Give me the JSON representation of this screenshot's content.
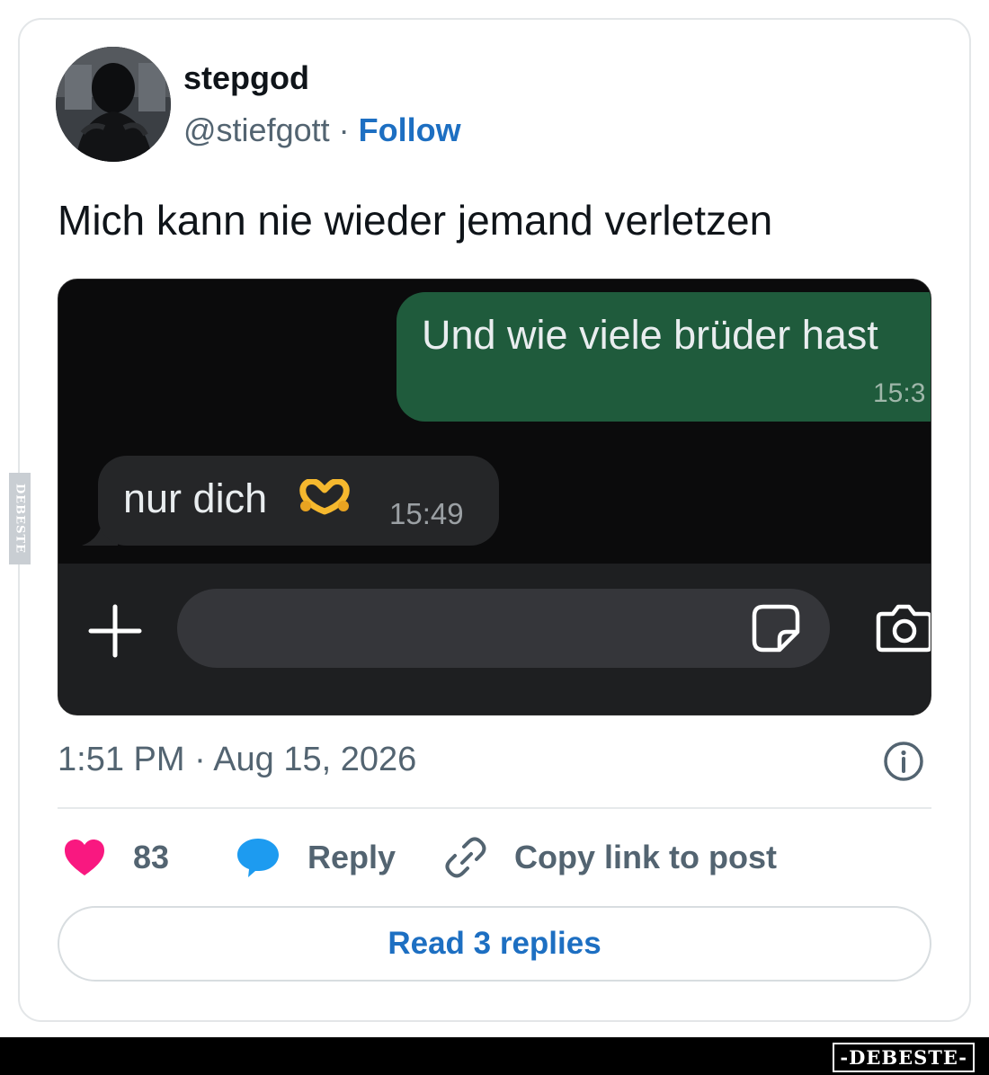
{
  "tweet": {
    "display_name": "stepgod",
    "handle": "@stiefgott",
    "separator": " · ",
    "follow_label": "Follow",
    "text": "Mich kann nie wieder jemand verletzen",
    "timestamp": "1:51 PM · Aug 15, 2026"
  },
  "screenshot": {
    "outgoing": {
      "text": "Und wie viele brüder hast",
      "time": "15:3"
    },
    "incoming": {
      "text": "nur dich",
      "emoji_icon": "heart-hands-icon",
      "time": "15:49"
    }
  },
  "actions": {
    "like_count": "83",
    "reply_label": "Reply",
    "copy_label": "Copy link to post",
    "read_replies_label": "Read 3 replies"
  },
  "watermark": {
    "side": "DEBESTE",
    "footer": "-DEBESTE-"
  },
  "colors": {
    "accent": "#1d6fc2",
    "like": "#f91880",
    "reply_icon": "#1d9bf0",
    "chat_outgoing": "#1f5b3c",
    "chat_incoming": "#252628",
    "chat_background": "#0b0b0c"
  }
}
